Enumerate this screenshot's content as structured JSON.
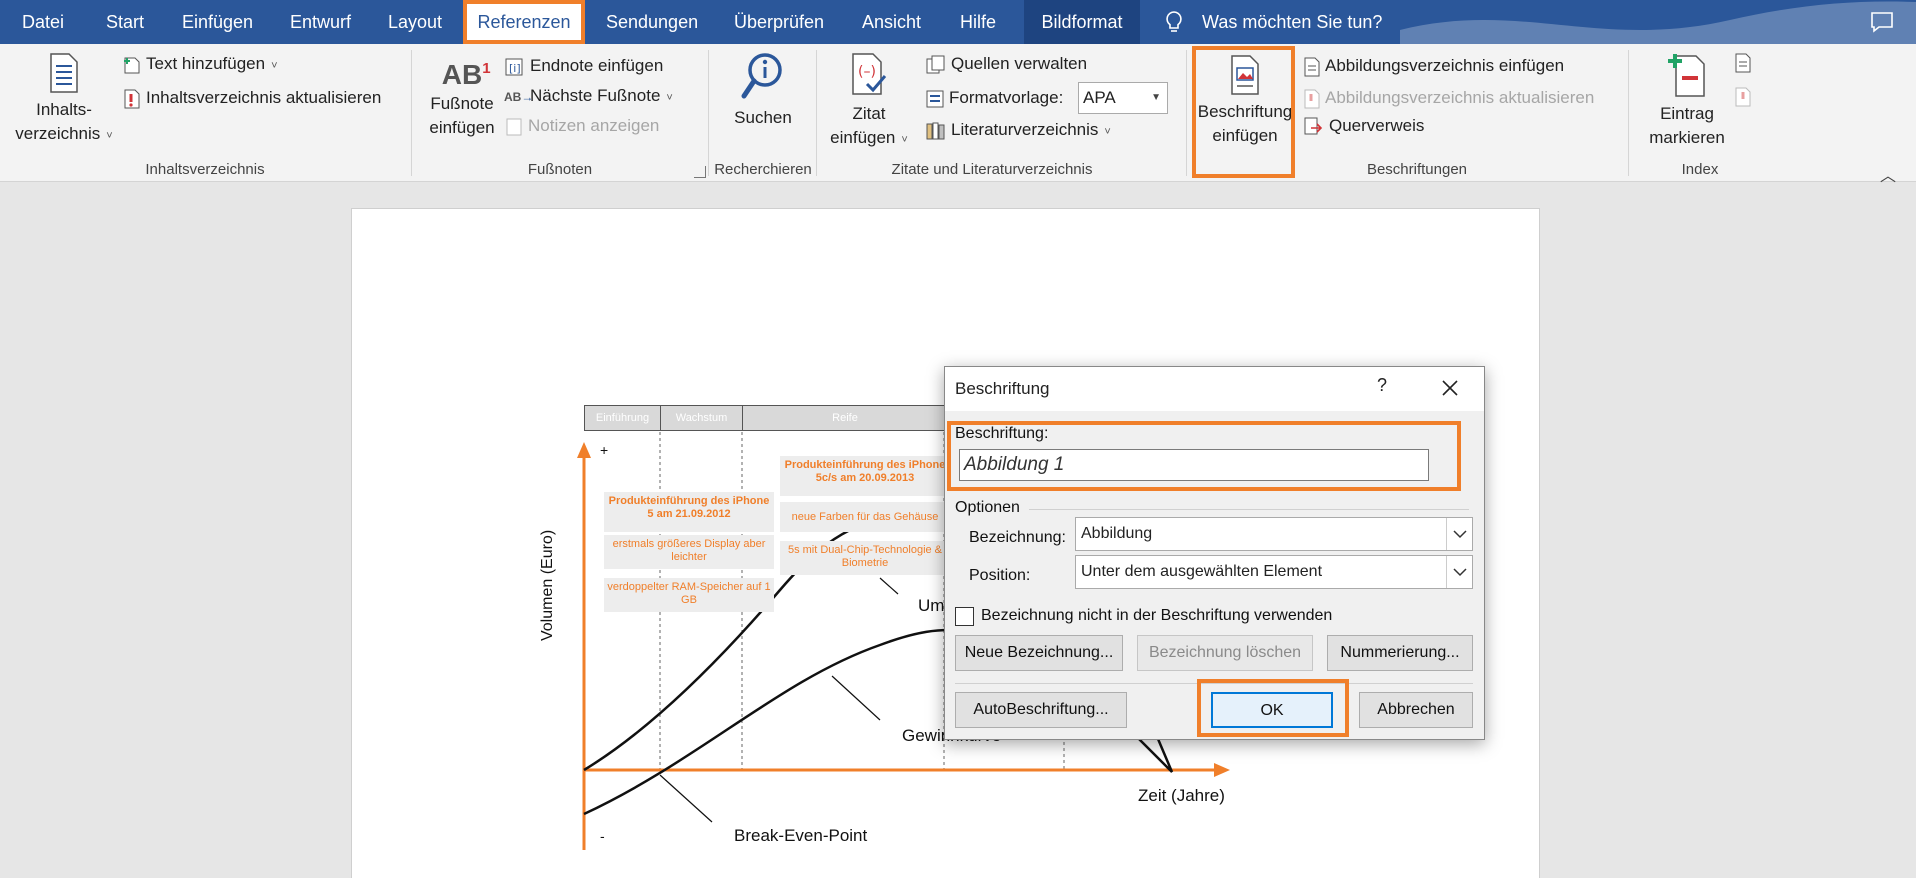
{
  "tabs": [
    {
      "label": "Datei"
    },
    {
      "label": "Start"
    },
    {
      "label": "Einfügen"
    },
    {
      "label": "Entwurf"
    },
    {
      "label": "Layout"
    },
    {
      "label": "Referenzen",
      "active": true
    },
    {
      "label": "Sendungen"
    },
    {
      "label": "Überprüfen"
    },
    {
      "label": "Ansicht"
    },
    {
      "label": "Hilfe"
    },
    {
      "label": "Bildformat"
    }
  ],
  "tell_me": "Was möchten Sie tun?",
  "ribbon": {
    "toc": {
      "big_button_line1": "Inhalts-",
      "big_button_line2": "verzeichnis",
      "add_text": "Text hinzufügen",
      "update_toc": "Inhaltsverzeichnis aktualisieren",
      "group_label": "Inhaltsverzeichnis"
    },
    "footnotes": {
      "insert_line1": "Fußnote",
      "insert_line2": "einfügen",
      "icon_text": "AB",
      "icon_sup": "1",
      "small_icon_text": "AB",
      "insert_endnote": "Endnote einfügen",
      "next_footnote": "Nächste Fußnote",
      "show_notes": "Notizen anzeigen",
      "group_label": "Fußnoten"
    },
    "research": {
      "search": "Suchen",
      "group_label": "Recherchieren"
    },
    "citations": {
      "insert_line1": "Zitat",
      "insert_line2": "einfügen",
      "manage_sources": "Quellen verwalten",
      "style_label": "Formatvorlage:",
      "style_value": "APA",
      "bibliography": "Literaturverzeichnis",
      "group_label": "Zitate und Literaturverzeichnis"
    },
    "captions": {
      "insert_line1": "Beschriftung",
      "insert_line2": "einfügen",
      "insert_tof": "Abbildungsverzeichnis einfügen",
      "update_tof": "Abbildungsverzeichnis aktualisieren",
      "cross_ref": "Querverweis",
      "group_label": "Beschriftungen"
    },
    "index": {
      "mark_line1": "Eintrag",
      "mark_line2": "markieren",
      "group_label": "Index"
    }
  },
  "figure": {
    "phases": [
      "Einführung",
      "Wachstum",
      "Reife"
    ],
    "plus": "+",
    "minus": "-",
    "y_label": "Volumen (Euro)",
    "x_label": "Zeit (Jahre)",
    "break_even": "Break-Even-Point",
    "revenue_partial": "Um",
    "profit_partial": "Gewinnkurve",
    "notes_left": [
      {
        "text": "Produkteinführung des iPhone 5 am 21.09.2012",
        "bold": true
      },
      {
        "text": "erstmals größeres Display aber leichter"
      },
      {
        "text": "verdoppelter RAM-Speicher auf 1 GB"
      }
    ],
    "notes_right": [
      {
        "text": "Produkteinführung des iPhone 5c/s am 20.09.2013",
        "bold": true
      },
      {
        "text": "neue Farben für das Gehäuse"
      },
      {
        "text": "5s mit Dual-Chip-Technologie & Biometrie"
      }
    ]
  },
  "dialog": {
    "title": "Beschriftung",
    "help": "?",
    "caption_label": "Beschriftung:",
    "caption_value": "Abbildung 1",
    "options_label": "Optionen",
    "label_label": "Bezeichnung:",
    "label_value": "Abbildung",
    "position_label": "Position:",
    "position_value": "Unter dem ausgewählten Element",
    "exclude_label": "Bezeichnung nicht in der Beschriftung verwenden",
    "exclude_checked": false,
    "new_label": "Neue Bezeichnung...",
    "delete_label": "Bezeichnung löschen",
    "numbering": "Nummerierung...",
    "autocaption": "AutoBeschriftung...",
    "ok": "OK",
    "cancel": "Abbrechen"
  },
  "colors": {
    "accent": "#2b579a",
    "highlight": "#f07f2a"
  }
}
